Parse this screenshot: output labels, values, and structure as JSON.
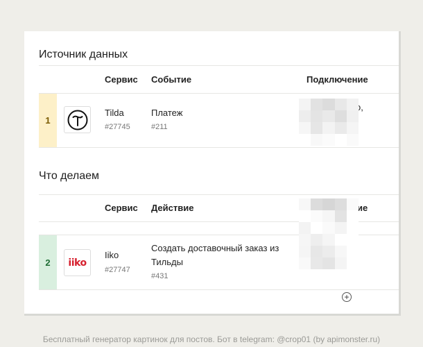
{
  "source": {
    "title": "Источник данных",
    "headers": {
      "service": "Сервис",
      "event": "Событие",
      "connection": "Подключение"
    },
    "row": {
      "number": "1",
      "service_name": "Tilda",
      "service_id": "#27745",
      "event_name": "Платеж",
      "event_id": "#211",
      "connection_visible": "o,"
    }
  },
  "action": {
    "title": "Что делаем",
    "headers": {
      "service": "Сервис",
      "action": "Действие",
      "connection_partial": "ие"
    },
    "row": {
      "number": "2",
      "service_name": "Iiko",
      "service_id": "#27747",
      "action_line1": "Создать доставочный заказ из",
      "action_line2": "Тильды",
      "action_id": "#431"
    }
  },
  "logos": {
    "tilda": "tilda-logo",
    "iiko": "iiko"
  },
  "add_button": "⊕",
  "footer": "Бесплатный генератор картинок для постов. Бот в telegram: @crop01 (by apimonster.ru)",
  "colors": {
    "background": "#efeee9",
    "row1_badge": "#fdf0c8",
    "row2_badge": "#d9efdf",
    "iiko_red": "#d6202e"
  }
}
